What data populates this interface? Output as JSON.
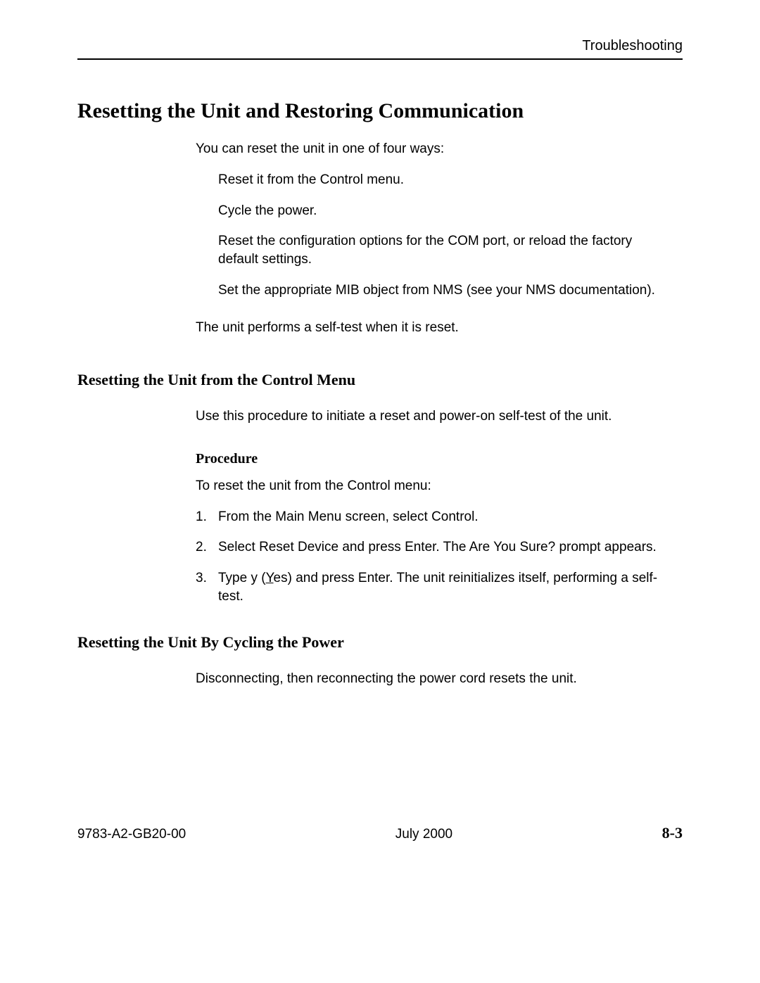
{
  "header": {
    "label": "Troubleshooting"
  },
  "title": "Resetting the Unit and Restoring Communication",
  "intro": "You can reset the unit in one of four ways:",
  "bullets": [
    "Reset it from the Control menu.",
    "Cycle the power.",
    "Reset the configuration options for the COM port, or reload the factory default settings.",
    "Set the appropriate MIB object from NMS (see your NMS documentation)."
  ],
  "after_bullets": "The unit performs a self-test when it is reset.",
  "section1": {
    "title": "Resetting the Unit from the Control Menu",
    "text": "Use this procedure to initiate a reset and power-on self-test of the unit.",
    "procedure_label": "Procedure",
    "procedure_intro": "To reset the unit from the Control menu:",
    "steps": {
      "n1": "1.",
      "t1": "From the Main Menu screen, select Control.",
      "n2": "2.",
      "t2a": "Select Reset Device and press Enter. The ",
      "t2b": "Are You Sure?",
      "t2c": " prompt appears.",
      "n3": "3.",
      "t3a": "Type y (",
      "t3u": "Y",
      "t3b": "es) and press Enter. The unit reinitializes itself, performing a self-test."
    }
  },
  "section2": {
    "title": "Resetting the Unit By Cycling the Power",
    "text": "Disconnecting, then reconnecting the power cord resets the unit."
  },
  "footer": {
    "doc": "9783-A2-GB20-00",
    "date": "July 2000",
    "page": "8-3"
  }
}
